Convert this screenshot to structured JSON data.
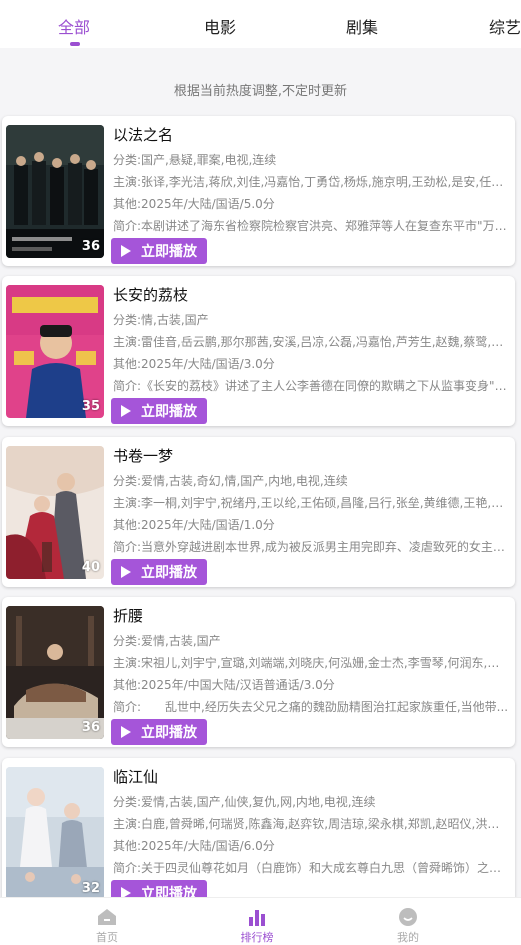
{
  "tabs": {
    "items": [
      "全部",
      "电影",
      "剧集",
      "综艺"
    ],
    "active": "全部"
  },
  "notice": "根据当前热度调整,不定时更新",
  "play_label": "立即播放",
  "cards": [
    {
      "title": "以法之名",
      "genre": "分类:国产,悬疑,罪案,电视,连续",
      "cast": "主演:张译,李光洁,蒋欣,刘佳,冯嘉怡,丁勇岱,杨烁,施京明,王劲松,是安,任重,郝...",
      "other": "其他:2025年/大陆/国语/5.0分",
      "intro": "简介:本剧讲述了海东省检察院检察官洪亮、郑雅萍等人在复查东平市\"万海...",
      "rank": "36"
    },
    {
      "title": "长安的荔枝",
      "genre": "分类:情,古装,国产",
      "cast": "主演:雷佳音,岳云鹏,那尔那茜,安溪,吕凉,公磊,冯嘉怡,芦芳生,赵魏,蔡鹭,闫必果...",
      "other": "其他:2025年/大陆/国语/3.0分",
      "intro": "简介:《长安的荔枝》讲述了主人公李善德在同僚的欺瞒之下从监事变身\"荔...",
      "rank": "35"
    },
    {
      "title": "书卷一梦",
      "genre": "分类:爱情,古装,奇幻,情,国产,内地,电视,连续",
      "cast": "主演:李一桐,刘宇宁,祝绪丹,王以纶,王佑硕,昌隆,吕行,张垒,黄维德,王艳,郑国霖...",
      "other": "其他:2025年/大陆/国语/1.0分",
      "intro": "简介:当意外穿越进剧本世界,成为被反派男主用完即弃、凌虐致死的女主角...",
      "rank": "40"
    },
    {
      "title": "折腰",
      "genre": "分类:爱情,古装,国产",
      "cast": "主演:宋祖儿,刘宇宁,宣璐,刘端端,刘晓庆,何泓姗,金士杰,李雪琴,何润东,王成思...",
      "other": "其他:2025年/中国大陆/汉语普通话/3.0分",
      "intro": "简介:　　乱世中,经历失去父兄之痛的魏劭励精图治扛起家族重任,当他带...",
      "rank": "36"
    },
    {
      "title": "临江仙",
      "genre": "分类:爱情,古装,国产,仙侠,复仇,网,内地,电视,连续",
      "cast": "主演:白鹿,曾舜晞,何瑞贤,陈鑫海,赵弈钦,周洁琼,梁永棋,郑凯,赵昭仪,洪尧,孙昌...",
      "other": "其他:2025年/大陆/国语/6.0分",
      "intro": "简介:关于四灵仙尊花如月（白鹿饰）和大成玄尊白九思（曾舜晞饰）之间的...",
      "rank": "32"
    }
  ],
  "bottom_nav": {
    "items": [
      "首页",
      "排行榜",
      "我的"
    ],
    "active": "排行榜"
  },
  "colors": {
    "accent": "#9b4fd1",
    "button": "#a555d9"
  }
}
